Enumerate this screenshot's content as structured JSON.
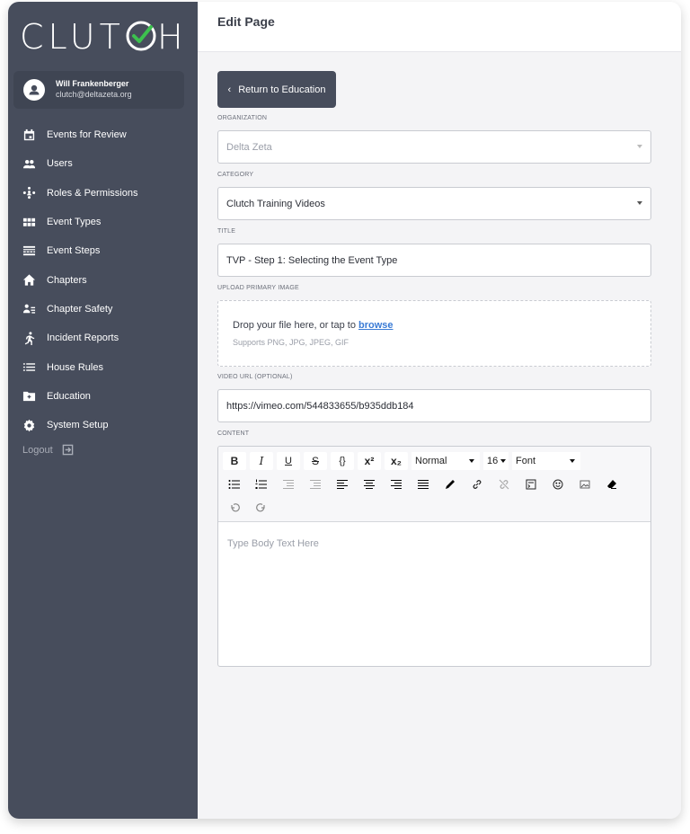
{
  "app": {
    "logo_text": "CLUTCH"
  },
  "user": {
    "name": "Will Frankenberger",
    "email": "clutch@deltazeta.org"
  },
  "sidebar": {
    "items": [
      {
        "label": "Events for Review",
        "icon": "calendar-icon"
      },
      {
        "label": "Users",
        "icon": "users-icon"
      },
      {
        "label": "Roles & Permissions",
        "icon": "roles-icon"
      },
      {
        "label": "Event Types",
        "icon": "grid-icon"
      },
      {
        "label": "Event Steps",
        "icon": "steps-icon"
      },
      {
        "label": "Chapters",
        "icon": "home-icon"
      },
      {
        "label": "Chapter Safety",
        "icon": "safety-icon"
      },
      {
        "label": "Incident Reports",
        "icon": "running-icon"
      },
      {
        "label": "House Rules",
        "icon": "list-icon"
      },
      {
        "label": "Education",
        "icon": "folder-icon"
      },
      {
        "label": "System Setup",
        "icon": "gear-icon"
      }
    ],
    "logout_label": "Logout"
  },
  "header": {
    "title": "Edit Page"
  },
  "form": {
    "back_label": "Return to Education",
    "organization": {
      "label": "ORGANIZATION",
      "value": "Delta Zeta"
    },
    "category": {
      "label": "CATEGORY",
      "value": "Clutch Training Videos"
    },
    "title_field": {
      "label": "TITLE",
      "value": "TVP - Step 1: Selecting the Event Type"
    },
    "upload": {
      "label": "UPLOAD PRIMARY IMAGE",
      "prompt": "Drop your file here, or tap to ",
      "browse": "browse",
      "supports": "Supports PNG, JPG, JPEG, GIF"
    },
    "video": {
      "label": "VIDEO URL (OPTIONAL)",
      "value": "https://vimeo.com/544833655/b935ddb184"
    },
    "content": {
      "label": "CONTENT",
      "placeholder": "Type Body Text Here",
      "toolbar": {
        "bold": "B",
        "italic": "I",
        "underline": "U",
        "strike": "S",
        "code": "{}",
        "superscript": "x²",
        "subscript": "x₂",
        "heading_select": "Normal",
        "size_select": "16",
        "font_select": "Font"
      }
    }
  },
  "colors": {
    "sidebar": "#474d5c",
    "accent_check": "#3cc14e",
    "link": "#3a7bd5"
  }
}
